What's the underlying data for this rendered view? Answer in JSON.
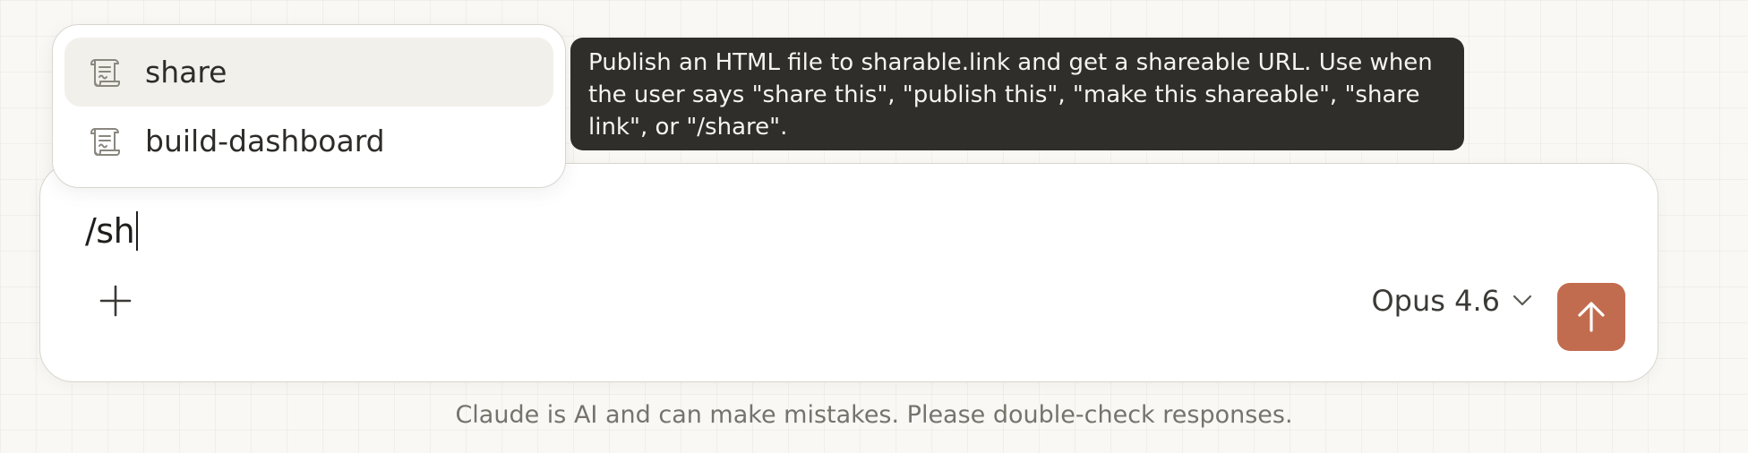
{
  "command_menu": {
    "items": [
      {
        "label": "share",
        "icon": "scroll-icon",
        "selected": true
      },
      {
        "label": "build-dashboard",
        "icon": "scroll-icon",
        "selected": false
      }
    ]
  },
  "tooltip": {
    "text": "Publish an HTML file to sharable.link and get a shareable URL. Use when the user says \"share this\", \"publish this\", \"make this shareable\", \"share link\", or \"/share\"."
  },
  "composer": {
    "input_value": "/sh",
    "add_icon": "plus-icon",
    "model_label": "Opus 4.6",
    "model_dropdown_icon": "chevron-down-icon",
    "send_icon": "arrow-up-icon"
  },
  "footer": {
    "disclaimer": "Claude is AI and can make mistakes. Please double-check responses."
  },
  "colors": {
    "background": "#f9f8f4",
    "send_button": "#c26c4f",
    "tooltip_bg": "#2f2e2b",
    "selected_item_bg": "#f2f0eb"
  }
}
